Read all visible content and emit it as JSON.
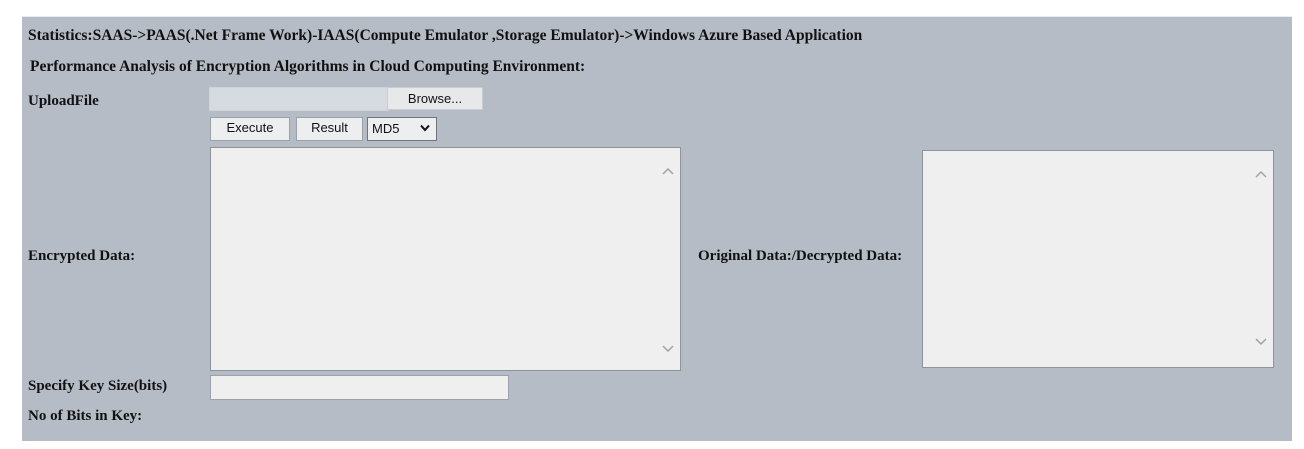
{
  "header": {
    "title": "Statistics:SAAS->PAAS(.Net Frame Work)-IAAS(Compute Emulator ,Storage Emulator)->Windows Azure Based Application",
    "subtitle": "Performance Analysis of Encryption Algorithms in Cloud Computing Environment:"
  },
  "upload": {
    "label": "UploadFile",
    "file_value": "",
    "browse_label": "Browse..."
  },
  "actions": {
    "execute_label": "Execute",
    "result_label": "Result",
    "algorithm_selected": "MD5"
  },
  "encrypted": {
    "label": "Encrypted Data:",
    "value": ""
  },
  "decrypted": {
    "label": "Original Data:/Decrypted Data:",
    "value": ""
  },
  "key": {
    "size_label": "Specify Key Size(bits)",
    "size_value": "",
    "bits_label": "No of Bits in Key:"
  },
  "icons": {
    "select_chevron": "chevron-down-icon",
    "scroll_up": "scroll-up-icon",
    "scroll_down": "scroll-down-icon"
  }
}
